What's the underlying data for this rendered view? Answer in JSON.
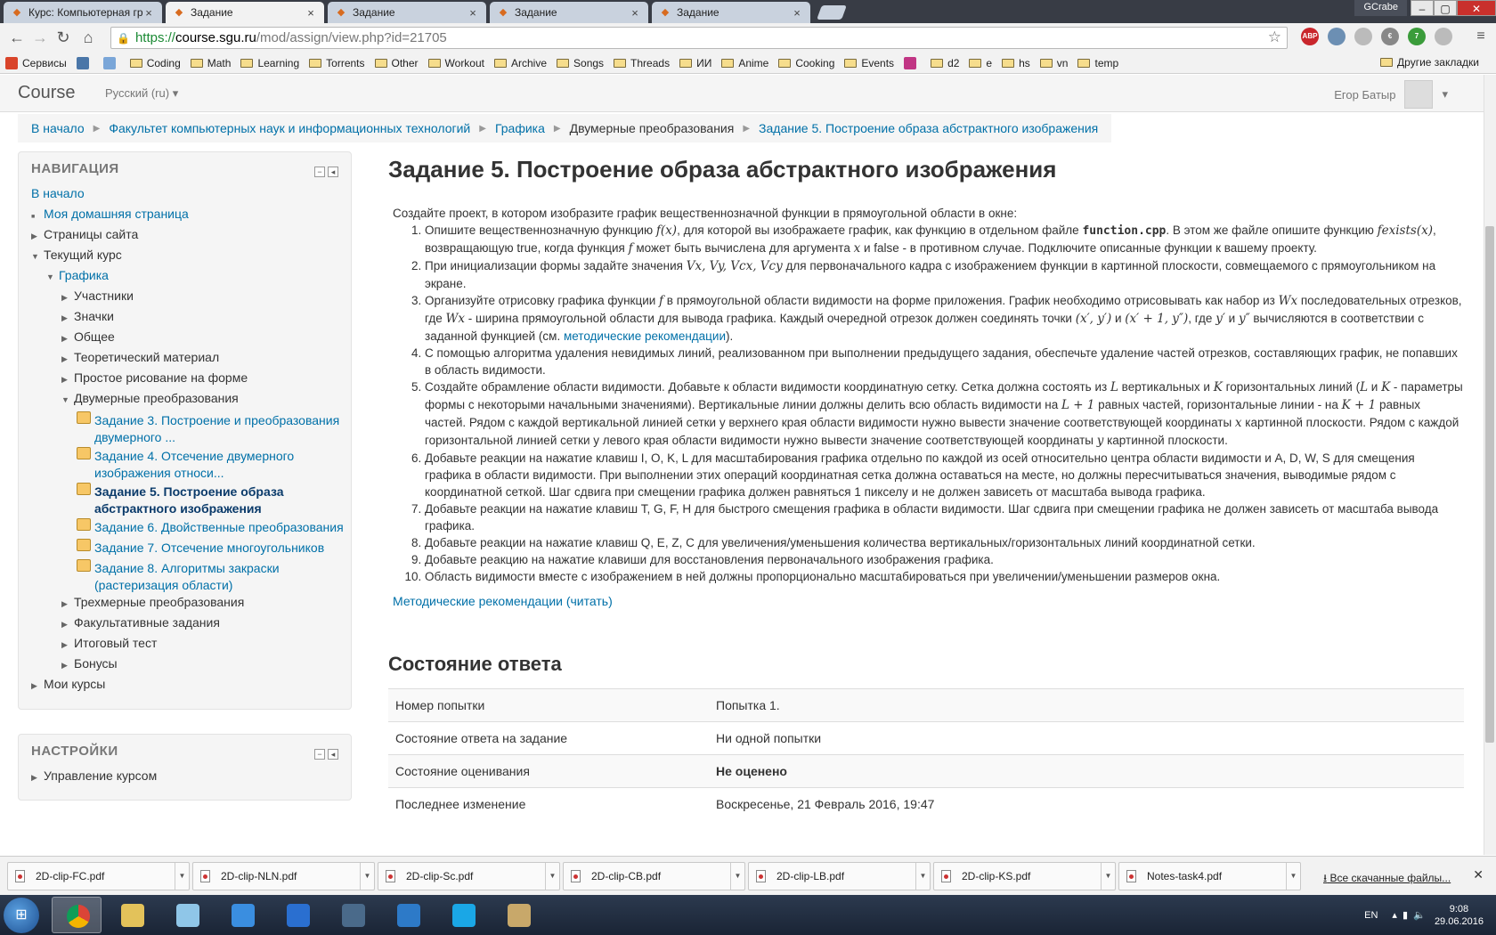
{
  "browser": {
    "tabs": [
      {
        "title": "Курс: Компьютерная гра",
        "active": false
      },
      {
        "title": "Задание",
        "active": true
      },
      {
        "title": "Задание",
        "active": false
      },
      {
        "title": "Задание",
        "active": false
      },
      {
        "title": "Задание",
        "active": false
      }
    ],
    "profile": "GCrabe",
    "url_scheme": "https://",
    "url_host": "course.sgu.ru",
    "url_path": "/mod/assign/view.php?id=21705",
    "extensions": [
      {
        "name": "abp-icon",
        "label": "ABP",
        "color": "#c9262c"
      },
      {
        "name": "drive-icon",
        "label": "",
        "color": "#6c8fb3"
      },
      {
        "name": "gear-ext-icon",
        "label": "",
        "color": "#bbbbbb"
      },
      {
        "name": "dict-icon",
        "label": "€",
        "color": "#888888"
      },
      {
        "name": "download-ext-icon",
        "label": "7",
        "color": "#3b9c3b"
      },
      {
        "name": "puzzle-icon",
        "label": "",
        "color": "#bbbbbb"
      }
    ],
    "bookmarks": [
      {
        "label": "Сервисы",
        "icon": "apps-icon",
        "type": "icon",
        "color": "#d9442a"
      },
      {
        "label": "",
        "icon": "vk-icon",
        "type": "icon",
        "color": "#4a76a8"
      },
      {
        "label": "",
        "icon": "mail-icon",
        "type": "icon",
        "color": "#7aa6d8"
      },
      {
        "label": "Coding",
        "icon": "folder-icon",
        "type": "folder"
      },
      {
        "label": "Math",
        "icon": "folder-icon",
        "type": "folder"
      },
      {
        "label": "Learning",
        "icon": "folder-icon",
        "type": "folder"
      },
      {
        "label": "Torrents",
        "icon": "folder-icon",
        "type": "folder"
      },
      {
        "label": "Other",
        "icon": "folder-icon",
        "type": "folder"
      },
      {
        "label": "Workout",
        "icon": "folder-icon",
        "type": "folder"
      },
      {
        "label": "Archive",
        "icon": "folder-icon",
        "type": "folder"
      },
      {
        "label": "Songs",
        "icon": "folder-icon",
        "type": "folder"
      },
      {
        "label": "Threads",
        "icon": "folder-icon",
        "type": "folder"
      },
      {
        "label": "ИИ",
        "icon": "folder-icon",
        "type": "folder"
      },
      {
        "label": "Anime",
        "icon": "folder-icon",
        "type": "folder"
      },
      {
        "label": "Cooking",
        "icon": "folder-icon",
        "type": "folder"
      },
      {
        "label": "Events",
        "icon": "folder-icon",
        "type": "folder"
      },
      {
        "label": "",
        "icon": "instagram-icon",
        "type": "icon",
        "color": "#c13584"
      },
      {
        "label": "d2",
        "icon": "folder-icon",
        "type": "folder"
      },
      {
        "label": "e",
        "icon": "folder-icon",
        "type": "folder"
      },
      {
        "label": "hs",
        "icon": "folder-icon",
        "type": "folder"
      },
      {
        "label": "vn",
        "icon": "folder-icon",
        "type": "folder"
      },
      {
        "label": "temp",
        "icon": "folder-icon",
        "type": "folder"
      }
    ],
    "other_bookmarks": "Другие закладки"
  },
  "header": {
    "brand": "Course",
    "language": "Русский (ru)",
    "user_name": "Егор Батыр"
  },
  "breadcrumb": [
    {
      "label": "В начало",
      "link": true
    },
    {
      "label": "Факультет компьютерных наук и информационных технологий",
      "link": true
    },
    {
      "label": "Графика",
      "link": true
    },
    {
      "label": "Двумерные преобразования",
      "link": false
    },
    {
      "label": "Задание 5. Построение образа абстрактного изображения",
      "link": true
    }
  ],
  "navigation": {
    "title": "НАВИГАЦИЯ",
    "home": "В начало",
    "dashboard": "Моя домашняя страница",
    "site_pages": "Страницы сайта",
    "current_course": "Текущий курс",
    "course": "Графика",
    "sections": [
      "Участники",
      "Значки",
      "Общее",
      "Теоретический материал",
      "Простое рисование на форме"
    ],
    "current_section": "Двумерные преобразования",
    "activities": [
      {
        "line1": "Задание 3. Построение и преобразования",
        "line2": "двумерного ...",
        "current": false
      },
      {
        "line1": "Задание 4. Отсечение двумерного",
        "line2": "изображения относи...",
        "current": false
      },
      {
        "line1": "Задание 5. Построение образа",
        "line2": "абстрактного изображения",
        "current": true
      },
      {
        "line1": "Задание 6. Двойственные преобразования",
        "line2": "",
        "current": false
      },
      {
        "line1": "Задание 7. Отсечение многоугольников",
        "line2": "",
        "current": false
      },
      {
        "line1": "Задание 8. Алгоритмы закраски",
        "line2": "(растеризация области)",
        "current": false
      }
    ],
    "more_sections": [
      "Трехмерные преобразования",
      "Факультативные задания",
      "Итоговый тест",
      "Бонусы"
    ],
    "my_courses": "Мои курсы"
  },
  "settings": {
    "title": "НАСТРОЙКИ",
    "item": "Управление курсом"
  },
  "assignment": {
    "title": "Задание 5. Построение образа абстрактного изображения",
    "intro": "Создайте проект, в котором изобразите график вещественнозначной функции в прямоугольной области в окне:",
    "items": {
      "i1a": "Опишите вещественнозначную функцию ",
      "i1m1": "f(x)",
      "i1b": ", для которой вы изображаете график, как функцию в отдельном файле ",
      "i1code": "function.cpp",
      "i1c": ". В этом же файле опишите функцию ",
      "i1m2": "fexists(x)",
      "i1d": ", возвращающую true, когда функция ",
      "i1m3": "f",
      "i1e": " может быть вычислена для аргумента ",
      "i1m4": "x",
      "i1f": " и false - в противном случае. Подключите описанные функции к вашему проекту.",
      "i2a": "При инициализации формы задайте значения ",
      "i2m": "Vx, Vy, Vcx, Vcy",
      "i2b": " для первоначального кадра с изображением функции в картинной плоскости, совмещаемого с прямоугольником на экране.",
      "i3a": "Организуйте отрисовку графика функции ",
      "i3m1": "f",
      "i3b": " в прямоугольной области видимости на форме приложения. График необходимо отрисовывать как набор из ",
      "i3m2": "Wx",
      "i3c": " последовательных отрезков, где ",
      "i3m3": "Wx",
      "i3d": " - ширина прямоугольной области для вывода графика. Каждый очередной отрезок должен соединять точки ",
      "i3m4": "(x′, y′)",
      "i3e": " и ",
      "i3m5": "(x′ + 1, y″)",
      "i3f": ", где ",
      "i3m6": "y′",
      "i3g": " и ",
      "i3m7": "y″",
      "i3h": " вычисляются в соответствии с заданной функцией (см. ",
      "i3link": "методические рекомендации",
      "i3i": ").",
      "i4": "С помощью алгоритма удаления невидимых линий, реализованном при выполнении предыдущего задания, обеспечьте удаление частей отрезков, составляющих график, не попавших в область видимости.",
      "i5a": "Создайте обрамление области видимости. Добавьте к области видимости координатную сетку. Сетка должна состоять из ",
      "i5m1": "L",
      "i5b": " вертикальных и ",
      "i5m2": "K",
      "i5c": " горизонтальных линий (",
      "i5m3": "L",
      "i5d": " и ",
      "i5m4": "K",
      "i5e": " - параметры формы с некоторыми начальными значениями). Вертикальные линии должны делить всю область видимости на ",
      "i5m5": "L + 1",
      "i5f": " равных частей, горизонтальные линии - на ",
      "i5m6": "K + 1",
      "i5g": " равных частей. Рядом с каждой вертикальной линией сетки у верхнего края области видимости нужно вывести значение соответствующей координаты ",
      "i5m7": "x",
      "i5h": " картинной плоскости. Рядом с каждой горизонтальной линией сетки у левого края области видимости нужно вывести значение соответствующей координаты ",
      "i5m8": "y",
      "i5i": " картинной плоскости.",
      "i6": "Добавьте реакции на нажатие клавиш I, O, K, L для масштабирования графика отдельно по каждой из осей относительно центра области видимости и A, D, W, S для смещения графика в области видимости. При выполнении этих операций координатная сетка должна оставаться на месте, но должны пересчитываться значения, выводимые рядом с координатной сеткой. Шаг сдвига при смещении графика должен равняться 1 пикселу и не должен зависеть от масштаба вывода графика.",
      "i7": "Добавьте реакции на нажатие клавиш T, G, F, H для быстрого смещения графика в области видимости. Шаг сдвига при смещении графика не должен зависеть от масштаба вывода графика.",
      "i8": "Добавьте реакции на нажатие клавиш Q, E, Z, C для увеличения/уменьшения количества вертикальных/горизонтальных линий координатной сетки.",
      "i9": "Добавьте реакцию на нажатие клавиши для восстановления первоначального изображения графика.",
      "i10": "Область видимости вместе с изображением в ней должны пропорционально масштабироваться при увеличении/уменьшении размеров окна."
    },
    "read_link": "Методические рекомендации (читать)"
  },
  "submission_status": {
    "title": "Состояние ответа",
    "rows": [
      {
        "label": "Номер попытки",
        "value": "Попытка 1.",
        "bold": false
      },
      {
        "label": "Состояние ответа на задание",
        "value": "Ни одной попытки",
        "bold": false
      },
      {
        "label": "Состояние оценивания",
        "value": "Не оценено",
        "bold": true
      },
      {
        "label": "Последнее изменение",
        "value": "Воскресенье, 21 Февраль 2016, 19:47",
        "bold": false
      }
    ]
  },
  "downloads": {
    "files": [
      "2D-clip-FC.pdf",
      "2D-clip-NLN.pdf",
      "2D-clip-Sc.pdf",
      "2D-clip-CB.pdf",
      "2D-clip-LB.pdf",
      "2D-clip-KS.pdf",
      "Notes-task4.pdf"
    ],
    "show_all": "Все скачанные файлы..."
  },
  "taskbar": {
    "apps": [
      {
        "name": "chrome-icon",
        "color": "#e8b020",
        "active": true
      },
      {
        "name": "explorer-icon",
        "color": "#e3c25a",
        "active": false
      },
      {
        "name": "notepad-icon",
        "color": "#8fc6e8",
        "active": false
      },
      {
        "name": "drop-icon",
        "color": "#3a8ee0",
        "active": false
      },
      {
        "name": "codeblocks-icon",
        "color": "#2a6fd0",
        "active": false
      },
      {
        "name": "steam-icon",
        "color": "#4a6a8a",
        "active": false
      },
      {
        "name": "visualstudio-icon",
        "color": "#2d7ac8",
        "active": false
      },
      {
        "name": "skype-icon",
        "color": "#1aa7e6",
        "active": false
      },
      {
        "name": "paint-icon",
        "color": "#c8a86a",
        "active": false
      }
    ],
    "lang": "EN",
    "time": "9:08",
    "date": "29.06.2016"
  }
}
